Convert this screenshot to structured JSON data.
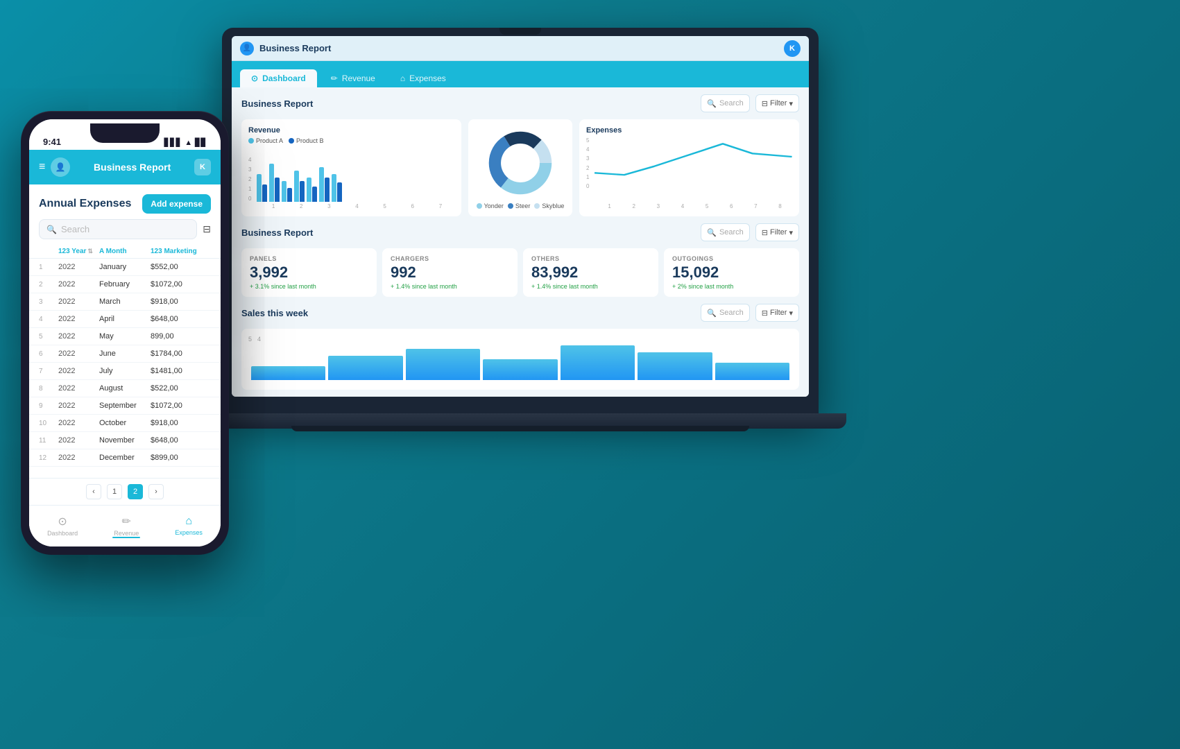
{
  "app": {
    "title": "Business Report",
    "close_label": "K",
    "tabs": [
      {
        "id": "dashboard",
        "label": "Dashboard",
        "icon": "⊙",
        "active": true
      },
      {
        "id": "revenue",
        "label": "Revenue",
        "icon": "✏"
      },
      {
        "id": "expenses",
        "label": "Expenses",
        "icon": "⌂"
      }
    ],
    "sections": {
      "business_report_title": "Business Report",
      "search_placeholder": "Search",
      "filter_label": "Filter",
      "revenue_title": "Revenue",
      "expenses_title": "Expenses",
      "sales_title": "Sales this week",
      "legend": {
        "product_a": "Product A",
        "product_b": "Product B",
        "yonder": "Yonder",
        "steer": "Steer",
        "skyblue": "Skyblue"
      },
      "metrics": [
        {
          "label": "PANELS",
          "value": "3,992",
          "change": "+ 3.1% since last month"
        },
        {
          "label": "CHARGERS",
          "value": "992",
          "change": "+ 1.4% since last month"
        },
        {
          "label": "OTHERS",
          "value": "83,992",
          "change": "+ 1.4% since last month"
        },
        {
          "label": "OUTGOINGS",
          "value": "15,092",
          "change": "+ 2% since last month"
        }
      ]
    }
  },
  "phone": {
    "time": "9:41",
    "status_icons": [
      "▋▋▋",
      "▲",
      "▊▊"
    ],
    "navbar": {
      "menu_icon": "≡",
      "user_icon": "👤",
      "title": "Business Report",
      "close": "K"
    },
    "content": {
      "title": "Annual Expenses",
      "add_button": "Add expense",
      "search_placeholder": "Search",
      "filter_icon": "⊟",
      "table": {
        "columns": [
          "",
          "Year",
          "Month",
          "Marketing"
        ],
        "rows": [
          {
            "num": "1",
            "year": "2022",
            "month": "January",
            "marketing": "$552,00"
          },
          {
            "num": "2",
            "year": "2022",
            "month": "February",
            "marketing": "$1072,00"
          },
          {
            "num": "3",
            "year": "2022",
            "month": "March",
            "marketing": "$918,00"
          },
          {
            "num": "4",
            "year": "2022",
            "month": "April",
            "marketing": "$648,00"
          },
          {
            "num": "5",
            "year": "2022",
            "month": "May",
            "marketing": "899,00"
          },
          {
            "num": "6",
            "year": "2022",
            "month": "June",
            "marketing": "$1784,00"
          },
          {
            "num": "7",
            "year": "2022",
            "month": "July",
            "marketing": "$1481,00"
          },
          {
            "num": "8",
            "year": "2022",
            "month": "August",
            "marketing": "$522,00"
          },
          {
            "num": "9",
            "year": "2022",
            "month": "September",
            "marketing": "$1072,00"
          },
          {
            "num": "10",
            "year": "2022",
            "month": "October",
            "marketing": "$918,00"
          },
          {
            "num": "11",
            "year": "2022",
            "month": "November",
            "marketing": "$648,00"
          },
          {
            "num": "12",
            "year": "2022",
            "month": "December",
            "marketing": "$899,00"
          }
        ],
        "pagination": {
          "prev": "‹",
          "page1": "1",
          "page2": "2",
          "next": "›"
        }
      },
      "bottom_nav": [
        {
          "icon": "⊙",
          "label": "Dashboard",
          "active": false
        },
        {
          "icon": "✏",
          "label": "Revenue",
          "active": false
        },
        {
          "icon": "⌂",
          "label": "Expenses",
          "active": true
        }
      ]
    }
  },
  "bar_chart": {
    "heights_a": [
      40,
      55,
      30,
      45,
      35,
      50,
      40
    ],
    "heights_b": [
      25,
      35,
      20,
      30,
      25,
      35,
      28
    ],
    "y_labels": [
      "4",
      "3",
      "2",
      "1",
      "0"
    ],
    "x_labels": [
      "1",
      "2",
      "3",
      "4",
      "5",
      "6",
      "7"
    ]
  },
  "donut": {
    "segments": [
      {
        "color": "#90d0e8",
        "pct": 35
      },
      {
        "color": "#3a7fc1",
        "pct": 30
      },
      {
        "color": "#1a3a5c",
        "pct": 20
      },
      {
        "color": "#7ab8e0",
        "pct": 15
      }
    ]
  },
  "line_chart": {
    "points": [
      2,
      1.8,
      2.5,
      3,
      4.5,
      3.5,
      2.8
    ],
    "y_labels": [
      "5",
      "4",
      "3",
      "2",
      "1",
      "0"
    ],
    "x_labels": [
      "1",
      "2",
      "3",
      "4",
      "5",
      "6",
      "7",
      "8"
    ]
  },
  "sales_bars": [
    20,
    35,
    45,
    30,
    50,
    40,
    25
  ]
}
